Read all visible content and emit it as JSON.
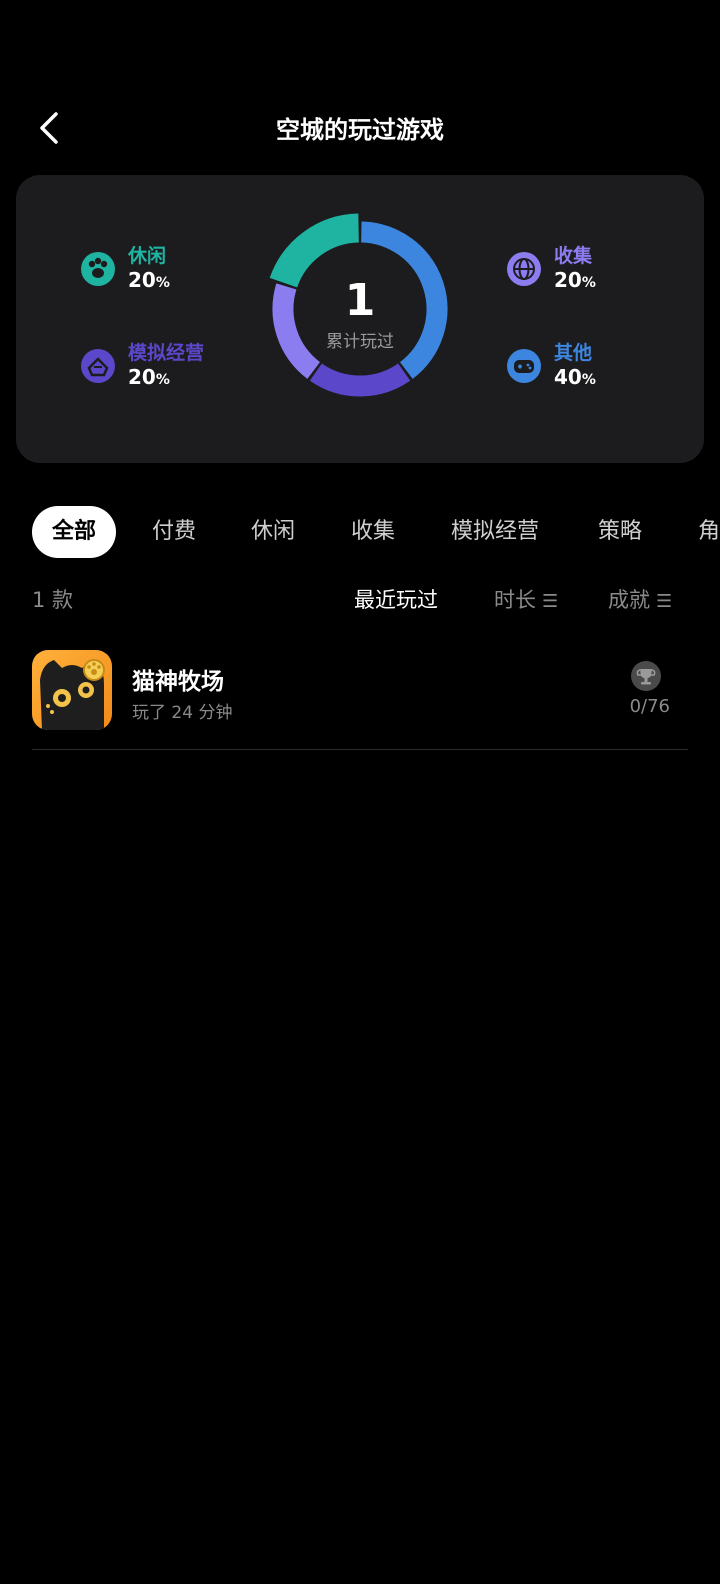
{
  "header": {
    "title": "空城的玩过游戏"
  },
  "stats": {
    "total_number": "1",
    "total_label": "累计玩过",
    "categories": [
      {
        "label": "休闲",
        "value": "20",
        "unit": "%",
        "color": "#1fb3a2",
        "icon": "paw-icon"
      },
      {
        "label": "模拟经营",
        "value": "20",
        "unit": "%",
        "color": "#5b47c9",
        "icon": "building-icon"
      },
      {
        "label": "收集",
        "value": "20",
        "unit": "%",
        "color": "#8b7cf0",
        "icon": "globe-icon"
      },
      {
        "label": "其他",
        "value": "40",
        "unit": "%",
        "color": "#3d86e0",
        "icon": "gamepad-icon"
      }
    ]
  },
  "tabs": [
    "全部",
    "付费",
    "休闲",
    "收集",
    "模拟经营",
    "策略",
    "角"
  ],
  "list": {
    "count": "1 款",
    "sort_recent": "最近玩过",
    "sort_duration": "时长",
    "sort_achievement": "成就"
  },
  "games": [
    {
      "name": "猫神牧场",
      "playtime": "玩了 24 分钟",
      "achievements": "0/76"
    }
  ]
}
